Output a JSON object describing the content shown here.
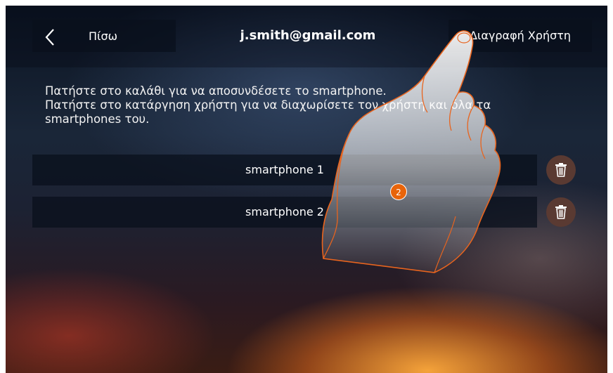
{
  "header": {
    "back_label": "Πίσω",
    "title": "j.smith@gmail.com",
    "delete_user_label": "Διαγραφή Χρήστη"
  },
  "instructions": {
    "line1": "Πατήστε στο καλάθι για να αποσυνδέσετε το smartphone.",
    "line2": "Πατήστε στο κατάργηση χρήστη για να διαχωρίσετε τον χρήστη και όλα τα smartphones του."
  },
  "devices": [
    {
      "label": "smartphone 1",
      "action_icon": "trash-icon"
    },
    {
      "label": "smartphone 2",
      "action_icon": "trash-icon"
    }
  ],
  "annotation": {
    "step": "2"
  },
  "colors": {
    "step_badge": "#e8640a",
    "hand_outline": "#e8641e",
    "trash_button": "#5a3a32"
  }
}
